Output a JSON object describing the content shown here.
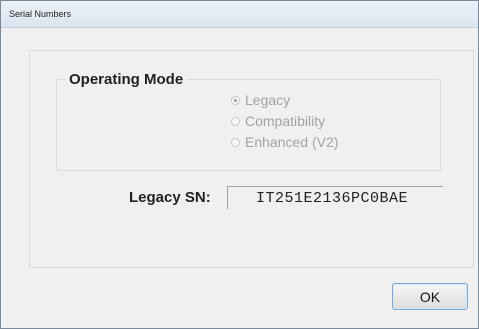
{
  "window": {
    "title": "Serial Numbers"
  },
  "operating_mode": {
    "label": "Operating Mode",
    "selected": "Legacy",
    "options": [
      {
        "label": "Legacy",
        "checked": true
      },
      {
        "label": "Compatibility",
        "checked": false
      },
      {
        "label": "Enhanced (V2)",
        "checked": false
      }
    ]
  },
  "serial": {
    "label": "Legacy SN:",
    "value": "IT251E2136PC0BAE"
  },
  "buttons": {
    "ok_label": "OK"
  },
  "colors": {
    "disabled_text": "#a3a3a3",
    "button_border": "#7aa7d6"
  }
}
